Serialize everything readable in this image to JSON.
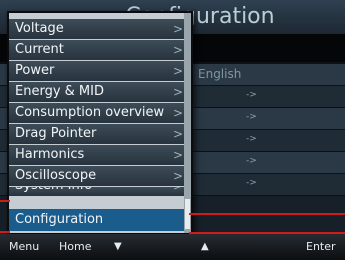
{
  "background": {
    "title": "Configuration",
    "language_value": "English",
    "rows": [
      {
        "value": "English",
        "arrow": ""
      },
      {
        "value": "",
        "arrow": "->"
      },
      {
        "value": "",
        "arrow": "->"
      },
      {
        "value": "",
        "arrow": "->"
      },
      {
        "value": "",
        "arrow": "->"
      },
      {
        "value": "",
        "arrow": "->"
      }
    ]
  },
  "menu": {
    "items": [
      {
        "label": "Voltage",
        "chevron": ">"
      },
      {
        "label": "Current",
        "chevron": ">"
      },
      {
        "label": "Power",
        "chevron": ">"
      },
      {
        "label": "Energy & MID",
        "chevron": ">"
      },
      {
        "label": "Consumption overview",
        "chevron": ">"
      },
      {
        "label": "Drag Pointer",
        "chevron": ">"
      },
      {
        "label": "Harmonics",
        "chevron": ">"
      },
      {
        "label": "Oscilloscope",
        "chevron": ">"
      },
      {
        "label": "System Info",
        "chevron": ">"
      },
      {
        "label": "Configuration",
        "chevron": ""
      }
    ],
    "selected_index": 9
  },
  "softkeys": {
    "menu": "Menu",
    "home": "Home",
    "down": "▼",
    "up": "▲",
    "enter": "Enter"
  },
  "colors": {
    "selected": "#1a5c8c",
    "highlight": "#d11a1a",
    "menu_item": "#27333d"
  }
}
